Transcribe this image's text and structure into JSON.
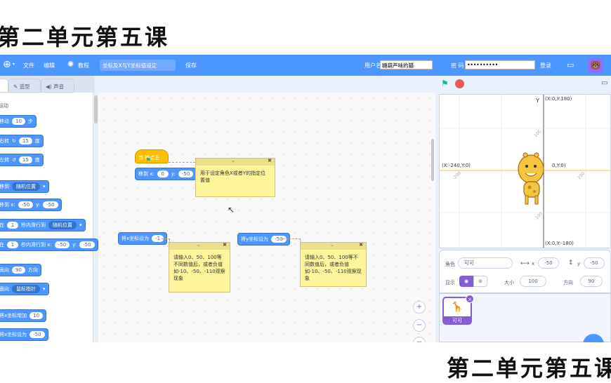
{
  "slide_title": "第二单元第五课",
  "menubar": {
    "file": "文件",
    "edit": "编辑",
    "tutorial": "教程",
    "project_title": "坐标及X与Y坐标值设定",
    "save": "保存",
    "username_label": "用户名",
    "username_value": "糖葫芦味的猫",
    "password_label": "密 码",
    "password_value": "••••••••••",
    "login": "登录"
  },
  "tabs": {
    "costumes": "造型",
    "sounds": "声音"
  },
  "palette": {
    "category": "运动",
    "blocks": [
      {
        "t1": "移动",
        "v1": "10",
        "t2": "步"
      },
      {
        "t1": "右转",
        "v1": "15",
        "t2": "度"
      },
      {
        "t1": "左转",
        "v1": "15",
        "t2": "度"
      },
      {
        "t1": "移到",
        "dd": "随机位置"
      },
      {
        "t1": "移到 x:",
        "v1": "-50",
        "t2": "y:",
        "v2": "-50"
      },
      {
        "t1": "在",
        "v1": "1",
        "t2": "秒内滑行到",
        "dd": "随机位置"
      },
      {
        "t1": "在",
        "v1": "1",
        "t2": "秒内滑行到 x:",
        "v2": "-50",
        "t3": "y:",
        "v3": "-50"
      },
      {
        "t1": "面向",
        "v1": "90",
        "t2": "方向"
      },
      {
        "t1": "面向",
        "dd": "鼠标指针"
      },
      {
        "t1": "将x坐标增加",
        "v1": "10"
      },
      {
        "t1": "将x坐标设为",
        "v1": "-50"
      }
    ]
  },
  "workspace": {
    "hat_label": "当 被点击",
    "goto_label": "移到 x:",
    "goto_x": "0",
    "goto_y_label": "y:",
    "goto_y": "-50",
    "set_x_label": "将x坐标设为",
    "set_x_value": "-1",
    "set_y_label": "将y坐标设为",
    "set_y_value": "-50",
    "note1": "用于设定角色X或者Y的指定位置值",
    "note2": "请输入0、50、100等不同数值后，或者负值如-10、-50、-110观察现象",
    "note3": "请输入0、50、100等不同数值后，或者负值如-10、-50、-110观察现象",
    "zoom_in": "+",
    "zoom_out": "−"
  },
  "stage": {
    "top_label": "(X:0,Y:180)",
    "bottom_label": "(X:0,Y:-180)",
    "left_label": "(X:-240,Y:0)",
    "center_label": "0,Y:0)",
    "y_axis": "Y",
    "tick_100": "100",
    "tick_m100": "-100",
    "tick_m200": "-200",
    "tick_200": "200"
  },
  "sprite_info": {
    "sprite_label": "角色",
    "sprite_name": "可可",
    "x_label": "x",
    "x_value": "-50",
    "y_label": "y",
    "y_value": "-50",
    "show_label": "显示",
    "size_label": "大小",
    "size_value": "100",
    "direction_label": "方向",
    "direction_value": "90"
  },
  "sprite_list": {
    "thumb_name": "可可"
  },
  "colors": {
    "motion": "#4c97ff",
    "events": "#ffbf00",
    "accent": "#855cd6",
    "note": "#fef49c"
  }
}
